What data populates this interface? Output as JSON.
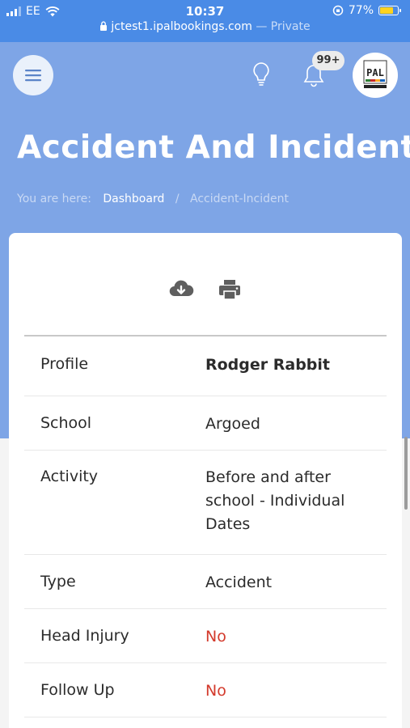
{
  "status_bar": {
    "carrier": "EE",
    "time": "10:37",
    "battery_percent": "77%",
    "battery_level": 0.77,
    "url": "jctest1.ipalbookings.com",
    "url_suffix": "— Private"
  },
  "header": {
    "notification_count": "99+",
    "avatar_logo_text": "PAL",
    "page_title": "Accident And Incident",
    "breadcrumb": {
      "prefix": "You are here:",
      "items": [
        "Dashboard",
        "Accident-Incident"
      ],
      "separator": "/"
    }
  },
  "toolbar": {
    "icons": [
      "cloud-download-icon",
      "print-icon"
    ]
  },
  "details": {
    "rows": [
      {
        "label": "Profile",
        "value": "Rodger Rabbit",
        "style": "bold"
      },
      {
        "label": "School",
        "value": "Argoed",
        "style": "normal"
      },
      {
        "label": "Activity",
        "value": "Before and after school - Individual Dates",
        "style": "normal"
      },
      {
        "label": "Type",
        "value": "Accident",
        "style": "normal"
      },
      {
        "label": "Head Injury",
        "value": "No",
        "style": "red"
      },
      {
        "label": "Follow Up",
        "value": "No",
        "style": "red"
      }
    ]
  },
  "colors": {
    "status_bar": "#4a8be6",
    "header_bg": "#7ea5e6",
    "negative_value": "#d33a2c"
  }
}
